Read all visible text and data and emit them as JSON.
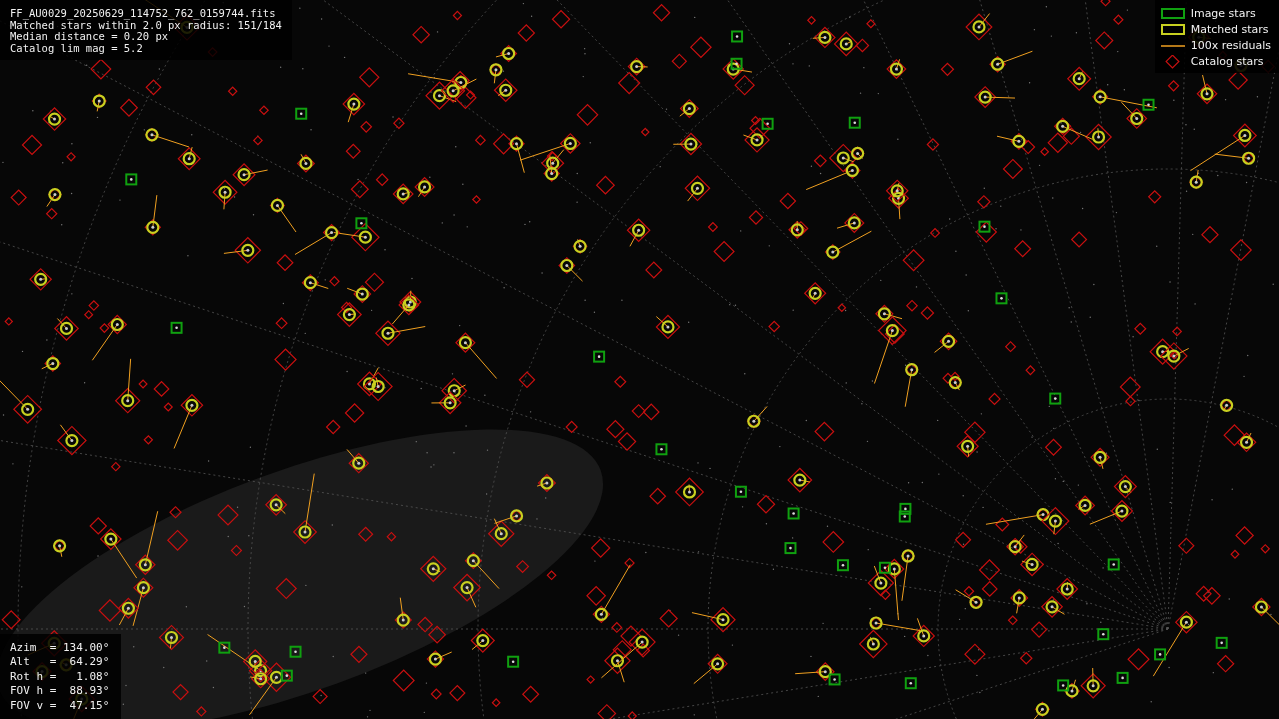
{
  "header": {
    "lines": [
      "FF_AU0029_20250629_114752_762_0159744.fits",
      "Matched stars within 2.0 px radius: 151/184",
      "Median distance = 0.20 px",
      "Catalog lim mag = 5.2"
    ]
  },
  "legend": [
    {
      "kind": "image",
      "label": "Image stars"
    },
    {
      "kind": "matched",
      "label": "Matched stars"
    },
    {
      "kind": "residual",
      "label": "100x residuals"
    },
    {
      "kind": "catalog",
      "label": "Catalog stars"
    }
  ],
  "pointing": {
    "lines": [
      "Azim  = 134.00°",
      "Alt   =  64.29°",
      "Rot h =   1.08°",
      "FOV h =  88.93°",
      "FOV v =  47.15°"
    ]
  }
}
